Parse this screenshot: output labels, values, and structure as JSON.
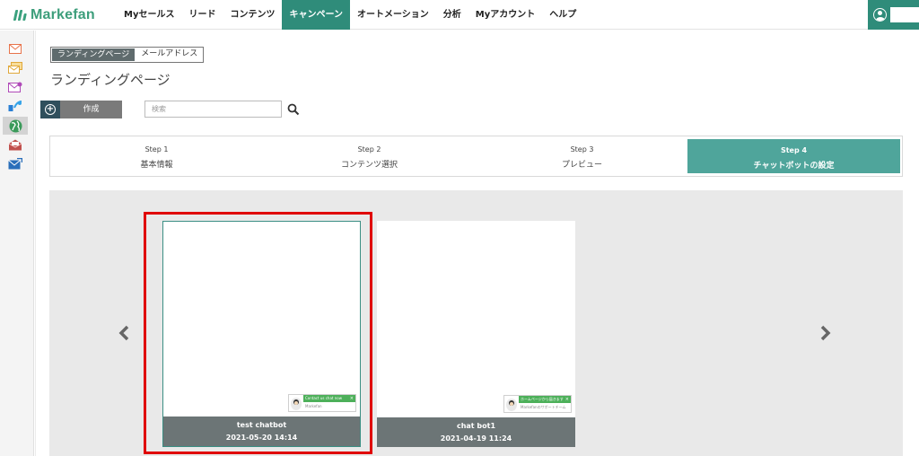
{
  "header": {
    "logo_text": "Markefan",
    "nav": [
      {
        "label": "Myセールス",
        "active": false
      },
      {
        "label": "リード",
        "active": false
      },
      {
        "label": "コンテンツ",
        "active": false
      },
      {
        "label": "キャンペーン",
        "active": true
      },
      {
        "label": "オートメーション",
        "active": false
      },
      {
        "label": "分析",
        "active": false
      },
      {
        "label": "Myアカウント",
        "active": false
      },
      {
        "label": "ヘルプ",
        "active": false
      }
    ],
    "user_icon": "user-circle-icon"
  },
  "sidebar": {
    "icons": [
      {
        "name": "mail-icon",
        "color": "#e8734a"
      },
      {
        "name": "mail-group-icon",
        "color": "#e0a83a"
      },
      {
        "name": "mail-add-icon",
        "color": "#b04ab8"
      },
      {
        "name": "social-share-icon",
        "color": "#2a7fd4"
      },
      {
        "name": "globe-icon",
        "color": "#3a9a5a",
        "active": true
      },
      {
        "name": "open-mail-icon",
        "color": "#c0504d"
      },
      {
        "name": "mail-send-icon",
        "color": "#2a6fba"
      }
    ]
  },
  "main": {
    "subtabs": [
      {
        "label": "ランディングページ",
        "active": true
      },
      {
        "label": "メールアドレス",
        "active": false
      }
    ],
    "page_title": "ランディングページ",
    "create_label": "作成",
    "search": {
      "placeholder": "検索",
      "value": ""
    },
    "steps": [
      {
        "num": "Step 1",
        "name": "基本情報",
        "active": false
      },
      {
        "num": "Step 2",
        "name": "コンテンツ選択",
        "active": false
      },
      {
        "num": "Step 3",
        "name": "プレビュー",
        "active": false
      },
      {
        "num": "Step 4",
        "name": "チャットボットの設定",
        "active": true
      }
    ],
    "cards": [
      {
        "name": "test chatbot",
        "date": "2021-05-20 14:14",
        "selected": true,
        "widget_text": "Contact us chat now",
        "widget_sub": "Markefan"
      },
      {
        "name": "chat bot1",
        "date": "2021-04-19 11:24",
        "selected": false,
        "widget_text": "ホームページから届きます",
        "widget_sub": "Markefanのサポートチーム"
      }
    ]
  },
  "colors": {
    "accent": "#2f8c7a",
    "step_active": "#4fa59b",
    "card_footer": "#6c7576",
    "highlight": "#e00000",
    "chat_green": "#4db05a"
  }
}
